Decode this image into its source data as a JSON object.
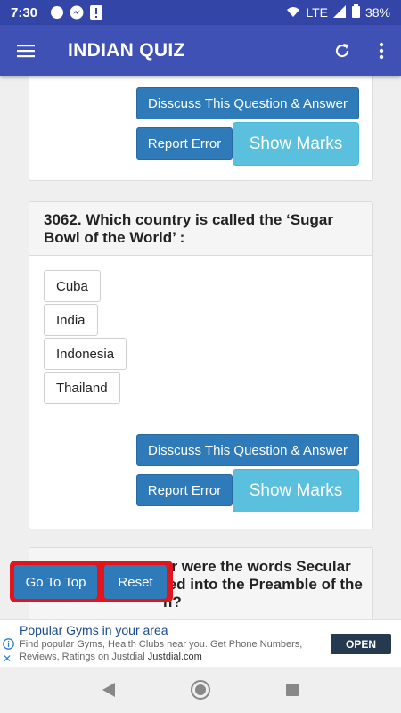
{
  "status_bar": {
    "time": "7:30",
    "network": "LTE",
    "battery": "38%"
  },
  "app_bar": {
    "title": "INDIAN QUIZ"
  },
  "cards": [
    {
      "discuss_label": "Disscuss This Question & Answer",
      "report_label": "Report Error",
      "marks_label": "Show Marks"
    },
    {
      "question": "3062. Which country is called the ‘Sugar Bowl of the World’ :",
      "options": [
        "Cuba",
        "India",
        "Indonesia",
        "Thailand"
      ],
      "discuss_label": "Disscuss This Question & Answer",
      "report_label": "Report Error",
      "marks_label": "Show Marks"
    },
    {
      "question_visible": "ar were the words Secular",
      "question_line2": "ted into the Preamble of the",
      "question_line3": "n?"
    }
  ],
  "floating": {
    "top_label": "Go To Top",
    "reset_label": "Reset"
  },
  "ad": {
    "title": "Popular Gyms in your area",
    "text": "Find popular Gyms, Health Clubs near you. Get Phone Numbers, Reviews, Ratings on Justdial",
    "brand": "Justdial.com",
    "button": "OPEN"
  }
}
